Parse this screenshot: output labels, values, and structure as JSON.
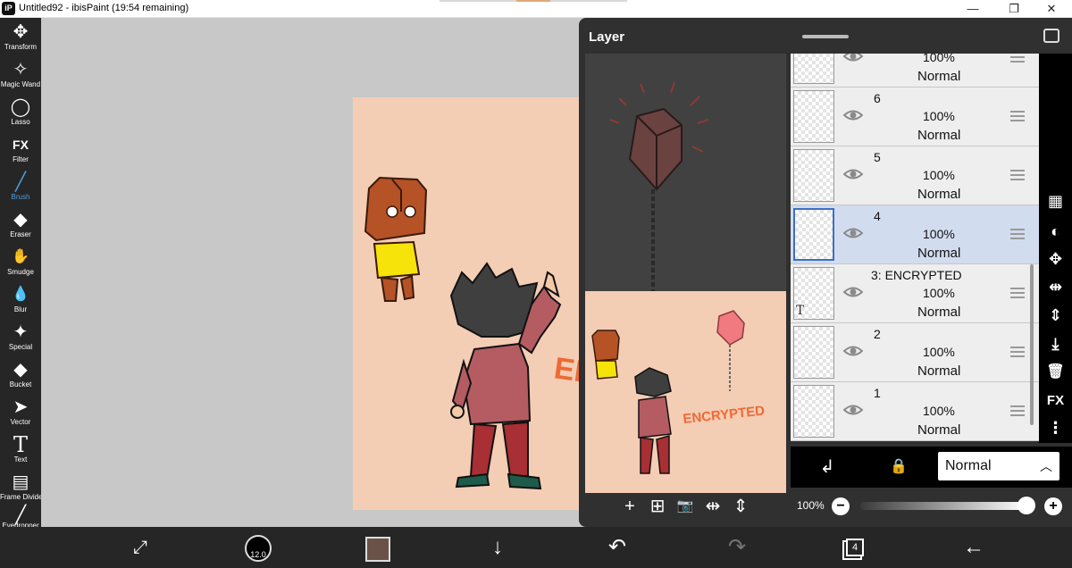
{
  "window": {
    "title": "Untitled92 - ibisPaint (19:54 remaining)",
    "minimize": "—",
    "restore": "❐",
    "close": "✕"
  },
  "tools": [
    {
      "label": "Transform",
      "icon": "move-icon",
      "glyph": "✥"
    },
    {
      "label": "Magic Wand",
      "icon": "magic-wand-icon",
      "glyph": "✧"
    },
    {
      "label": "Lasso",
      "icon": "lasso-icon",
      "glyph": "◯"
    },
    {
      "label": "Filter",
      "icon": "fx-icon",
      "glyph": "FX"
    },
    {
      "label": "Brush",
      "icon": "brush-icon",
      "glyph": "╱",
      "active": true
    },
    {
      "label": "Eraser",
      "icon": "eraser-icon",
      "glyph": "◆"
    },
    {
      "label": "Smudge",
      "icon": "smudge-icon",
      "glyph": "✋"
    },
    {
      "label": "Blur",
      "icon": "blur-icon",
      "glyph": "💧"
    },
    {
      "label": "Special",
      "icon": "special-icon",
      "glyph": "✦"
    },
    {
      "label": "Bucket",
      "icon": "bucket-icon",
      "glyph": "◆"
    },
    {
      "label": "Vector",
      "icon": "vector-icon",
      "glyph": "➤"
    },
    {
      "label": "Text",
      "icon": "text-icon",
      "glyph": "T"
    },
    {
      "label": "Frame Divider",
      "icon": "frame-divider-icon",
      "glyph": "▤"
    },
    {
      "label": "Eyedropper",
      "icon": "eyedropper-icon",
      "glyph": "╱"
    }
  ],
  "canvas": {
    "watermark_text": "EN",
    "preview_text": "ENCRYPTED"
  },
  "layer_panel": {
    "title": "Layer",
    "layers": [
      {
        "name": "",
        "opacity": "100%",
        "blend": "Normal",
        "selected": false
      },
      {
        "name": "6",
        "opacity": "100%",
        "blend": "Normal",
        "selected": false
      },
      {
        "name": "5",
        "opacity": "100%",
        "blend": "Normal",
        "selected": false
      },
      {
        "name": "4",
        "opacity": "100%",
        "blend": "Normal",
        "selected": true
      },
      {
        "name": "3: ENCRYPTED",
        "opacity": "100%",
        "blend": "Normal",
        "selected": false
      },
      {
        "name": "2",
        "opacity": "100%",
        "blend": "Normal",
        "selected": false
      },
      {
        "name": "1",
        "opacity": "100%",
        "blend": "Normal",
        "selected": false
      }
    ],
    "side_buttons": [
      {
        "icon": "checkerboard-icon",
        "glyph": "▦"
      },
      {
        "icon": "mask-icon",
        "glyph": "◐"
      },
      {
        "icon": "move-layer-icon",
        "glyph": "✥"
      },
      {
        "icon": "flip-horizontal-icon",
        "glyph": "⇹"
      },
      {
        "icon": "flip-vertical-icon",
        "glyph": "⇕"
      },
      {
        "icon": "merge-down-icon",
        "glyph": "⤓"
      },
      {
        "icon": "trash-icon",
        "glyph": "🗑"
      },
      {
        "icon": "fx-icon",
        "glyph": "FX"
      },
      {
        "icon": "more-icon",
        "glyph": "⋮"
      }
    ],
    "preview_tools": [
      {
        "icon": "add-layer-icon",
        "glyph": "+"
      },
      {
        "icon": "duplicate-layer-icon",
        "glyph": "⊞"
      },
      {
        "icon": "camera-icon",
        "glyph": "📷"
      },
      {
        "icon": "flip-horizontal-icon",
        "glyph": "⇹"
      },
      {
        "icon": "flip-vertical-icon",
        "glyph": "⇕"
      }
    ],
    "blend_mode": "Normal",
    "opacity_label": "100%",
    "opacity_value": 1.0
  },
  "bottom_bar": {
    "brush_size": "12.0",
    "layer_count": "4",
    "color": "#6b5248"
  }
}
